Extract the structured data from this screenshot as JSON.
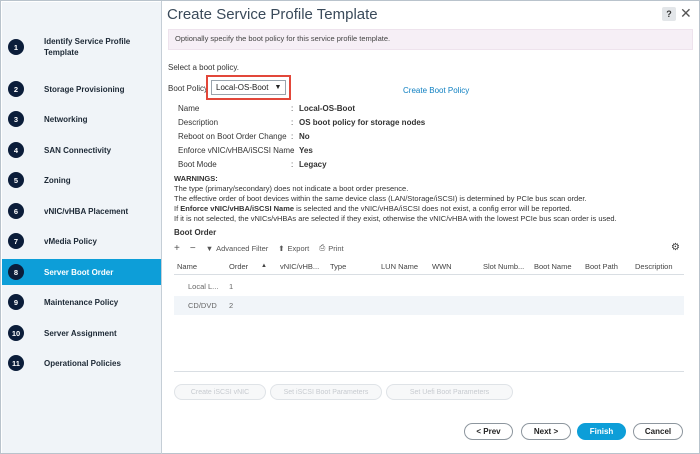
{
  "title": "Create Service Profile Template",
  "help_glyph": "?",
  "close_glyph": "✕",
  "steps": [
    {
      "num": "1",
      "label": "Identify Service Profile Template"
    },
    {
      "num": "2",
      "label": "Storage Provisioning"
    },
    {
      "num": "3",
      "label": "Networking"
    },
    {
      "num": "4",
      "label": "SAN Connectivity"
    },
    {
      "num": "5",
      "label": "Zoning"
    },
    {
      "num": "6",
      "label": "vNIC/vHBA Placement"
    },
    {
      "num": "7",
      "label": "vMedia Policy"
    },
    {
      "num": "8",
      "label": "Server Boot Order"
    },
    {
      "num": "9",
      "label": "Maintenance Policy"
    },
    {
      "num": "10",
      "label": "Server Assignment"
    },
    {
      "num": "11",
      "label": "Operational Policies"
    }
  ],
  "active_step": 8,
  "banner": "Optionally specify the boot policy for this service profile template.",
  "select_prompt": "Select a boot policy.",
  "boot_policy": {
    "label": "Boot Policy",
    "value": "Local-OS-Boot",
    "create_link": "Create Boot Policy"
  },
  "details": [
    {
      "key": "Name",
      "value": "Local-OS-Boot"
    },
    {
      "key": "Description",
      "value": "OS boot policy for storage nodes"
    },
    {
      "key": "Reboot on Boot Order Change",
      "value": "No"
    },
    {
      "key": "Enforce vNIC/vHBA/iSCSI Name",
      "value": "Yes"
    },
    {
      "key": "Boot Mode",
      "value": "Legacy"
    }
  ],
  "warnings": {
    "heading": "WARNINGS:",
    "line1": "The type (primary/secondary) does not indicate a boot order presence.",
    "line2": "The effective order of boot devices within the same device class (LAN/Storage/iSCSI) is determined by PCIe bus scan order.",
    "line3_pre": "If ",
    "line3_bold": "Enforce vNIC/vHBA/iSCSI Name",
    "line3_post": " is selected and the vNIC/vHBA/iSCSI does not exist, a config error will be reported.",
    "line4": "If it is not selected, the vNICs/vHBAs are selected if they exist, otherwise the vNIC/vHBA with the lowest PCIe bus scan order is used."
  },
  "boot_order": {
    "heading": "Boot Order",
    "toolbar": {
      "add": "+",
      "remove": "−",
      "advanced_filter": "Advanced Filter",
      "export": "Export",
      "print": "Print"
    },
    "columns": [
      "Name",
      "Order",
      "vNIC/vHB...",
      "Type",
      "LUN Name",
      "WWN",
      "Slot Numb...",
      "Boot Name",
      "Boot Path",
      "Description"
    ],
    "sort_arrow": "▲",
    "rows": [
      {
        "name": "Local L...",
        "order": "1"
      },
      {
        "name": "CD/DVD",
        "order": "2"
      }
    ]
  },
  "action_buttons": [
    "Create iSCSI vNIC",
    "Set iSCSI Boot Parameters",
    "Set Uefi Boot Parameters"
  ],
  "nav": {
    "prev": "< Prev",
    "next": "Next >",
    "finish": "Finish",
    "cancel": "Cancel"
  }
}
